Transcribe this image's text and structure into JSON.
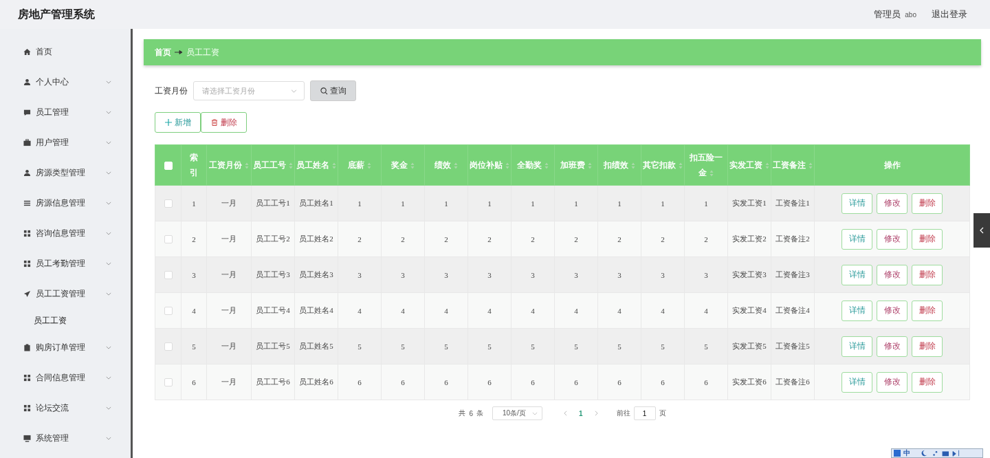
{
  "header": {
    "title": "房地产管理系统",
    "user_role": "管理员",
    "user_name": "abo",
    "logout": "退出登录"
  },
  "sidebar": {
    "items": [
      {
        "kind": "home",
        "label": "首页",
        "expandable": false
      },
      {
        "kind": "user",
        "label": "个人中心",
        "expandable": true
      },
      {
        "kind": "chat",
        "label": "员工管理",
        "expandable": true
      },
      {
        "kind": "briefcase",
        "label": "用户管理",
        "expandable": true
      },
      {
        "kind": "user",
        "label": "房源类型管理",
        "expandable": true
      },
      {
        "kind": "list",
        "label": "房源信息管理",
        "expandable": true
      },
      {
        "kind": "grid",
        "label": "咨询信息管理",
        "expandable": true
      },
      {
        "kind": "grid",
        "label": "员工考勤管理",
        "expandable": true
      },
      {
        "kind": "send",
        "label": "员工工资管理",
        "expandable": true,
        "children": [
          {
            "label": "员工工资",
            "selected": true
          }
        ]
      },
      {
        "kind": "clipboard",
        "label": "购房订单管理",
        "expandable": true
      },
      {
        "kind": "grid",
        "label": "合同信息管理",
        "expandable": true
      },
      {
        "kind": "grid",
        "label": "论坛交流",
        "expandable": true
      },
      {
        "kind": "monitor",
        "label": "系统管理",
        "expandable": true
      }
    ]
  },
  "breadcrumb": [
    "首页",
    "员工工资"
  ],
  "filter": {
    "label": "工资月份",
    "placeholder": "请选择工资月份",
    "search_button": "查询"
  },
  "toolbar": [
    {
      "kind": "add",
      "label": "新增"
    },
    {
      "kind": "delete",
      "label": "删除"
    }
  ],
  "table": {
    "header_checked": false,
    "columns": [
      {
        "label": "索引",
        "sortable": false
      },
      {
        "label": "工资月份",
        "sortable": true
      },
      {
        "label": "员工工号",
        "sortable": true
      },
      {
        "label": "员工姓名",
        "sortable": true
      },
      {
        "label": "底薪",
        "sortable": true
      },
      {
        "label": "奖金",
        "sortable": true
      },
      {
        "label": "绩效",
        "sortable": true
      },
      {
        "label": "岗位补贴",
        "sortable": true
      },
      {
        "label": "全勤奖",
        "sortable": true
      },
      {
        "label": "加班费",
        "sortable": true
      },
      {
        "label": "扣绩效",
        "sortable": true
      },
      {
        "label": "其它扣款",
        "sortable": true
      },
      {
        "label": "扣五险一金",
        "sortable": true
      },
      {
        "label": "实发工资",
        "sortable": true
      },
      {
        "label": "工资备注",
        "sortable": true
      },
      {
        "label": "操作",
        "sortable": false
      }
    ],
    "rows": [
      {
        "checked": false,
        "cells": [
          "1",
          "一月",
          "员工工号1",
          "员工姓名1",
          "1",
          "1",
          "1",
          "1",
          "1",
          "1",
          "1",
          "1",
          "1",
          "实发工资1",
          "工资备注1"
        ],
        "actions": [
          {
            "kind": "detail",
            "label": "详情"
          },
          {
            "kind": "edit",
            "label": "修改"
          },
          {
            "kind": "delete",
            "label": "删除"
          }
        ]
      },
      {
        "checked": false,
        "cells": [
          "2",
          "一月",
          "员工工号2",
          "员工姓名2",
          "2",
          "2",
          "2",
          "2",
          "2",
          "2",
          "2",
          "2",
          "2",
          "实发工资2",
          "工资备注2"
        ],
        "actions": [
          {
            "kind": "detail",
            "label": "详情"
          },
          {
            "kind": "edit",
            "label": "修改"
          },
          {
            "kind": "delete",
            "label": "删除"
          }
        ]
      },
      {
        "checked": false,
        "cells": [
          "3",
          "一月",
          "员工工号3",
          "员工姓名3",
          "3",
          "3",
          "3",
          "3",
          "3",
          "3",
          "3",
          "3",
          "3",
          "实发工资3",
          "工资备注3"
        ],
        "actions": [
          {
            "kind": "detail",
            "label": "详情"
          },
          {
            "kind": "edit",
            "label": "修改"
          },
          {
            "kind": "delete",
            "label": "删除"
          }
        ]
      },
      {
        "checked": false,
        "cells": [
          "4",
          "一月",
          "员工工号4",
          "员工姓名4",
          "4",
          "4",
          "4",
          "4",
          "4",
          "4",
          "4",
          "4",
          "4",
          "实发工资4",
          "工资备注4"
        ],
        "actions": [
          {
            "kind": "detail",
            "label": "详情"
          },
          {
            "kind": "edit",
            "label": "修改"
          },
          {
            "kind": "delete",
            "label": "删除"
          }
        ]
      },
      {
        "checked": false,
        "cells": [
          "5",
          "一月",
          "员工工号5",
          "员工姓名5",
          "5",
          "5",
          "5",
          "5",
          "5",
          "5",
          "5",
          "5",
          "5",
          "实发工资5",
          "工资备注5"
        ],
        "actions": [
          {
            "kind": "detail",
            "label": "详情"
          },
          {
            "kind": "edit",
            "label": "修改"
          },
          {
            "kind": "delete",
            "label": "删除"
          }
        ]
      },
      {
        "checked": false,
        "cells": [
          "6",
          "一月",
          "员工工号6",
          "员工姓名6",
          "6",
          "6",
          "6",
          "6",
          "6",
          "6",
          "6",
          "6",
          "6",
          "实发工资6",
          "工资备注6"
        ],
        "actions": [
          {
            "kind": "detail",
            "label": "详情"
          },
          {
            "kind": "edit",
            "label": "修改"
          },
          {
            "kind": "delete",
            "label": "删除"
          }
        ]
      }
    ]
  },
  "pagination": {
    "total_prefix": "共",
    "total": "6",
    "total_suffix": "条",
    "page_size": "10条/页",
    "pages": [
      {
        "label": "1",
        "selected": true
      }
    ],
    "goto_label": "前往",
    "goto_value": "1",
    "goto_suffix": "页"
  },
  "ime_toolbar": {
    "mode": "中"
  }
}
